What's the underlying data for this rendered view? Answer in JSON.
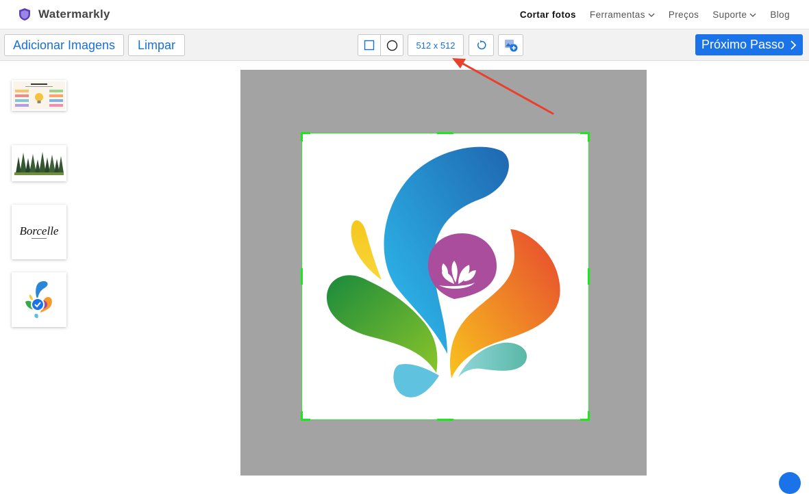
{
  "brand": {
    "name": "Watermarkly"
  },
  "nav": [
    {
      "label": "Cortar fotos",
      "active": true,
      "dropdown": false
    },
    {
      "label": "Ferramentas",
      "active": false,
      "dropdown": true
    },
    {
      "label": "Preços",
      "active": false,
      "dropdown": false
    },
    {
      "label": "Suporte",
      "active": false,
      "dropdown": true
    },
    {
      "label": "Blog",
      "active": false,
      "dropdown": false
    }
  ],
  "toolbar": {
    "add_images_label": "Adicionar Imagens",
    "clear_label": "Limpar",
    "crop_size": "512 x 512",
    "next_label": "Próximo Passo"
  },
  "icons": {
    "brand": "shield-logo-icon",
    "rect_crop": "square-icon",
    "circle_crop": "circle-icon",
    "rotate": "rotate-icon",
    "add_image": "add-image-icon",
    "next": "chevron-right-icon",
    "annotation": "red-arrow"
  },
  "thumbnails": [
    {
      "name": "infographic-thumbnail"
    },
    {
      "name": "forest-thumbnail"
    },
    {
      "name": "borcelle-thumbnail",
      "text": "Borcelle"
    },
    {
      "name": "splash-logo-thumbnail",
      "selected": true
    }
  ],
  "colors": {
    "accent": "#1a73e8",
    "crop_border": "#2ee62e",
    "canvas_bg": "#a3a3a3",
    "arrow": "#e8402c"
  }
}
